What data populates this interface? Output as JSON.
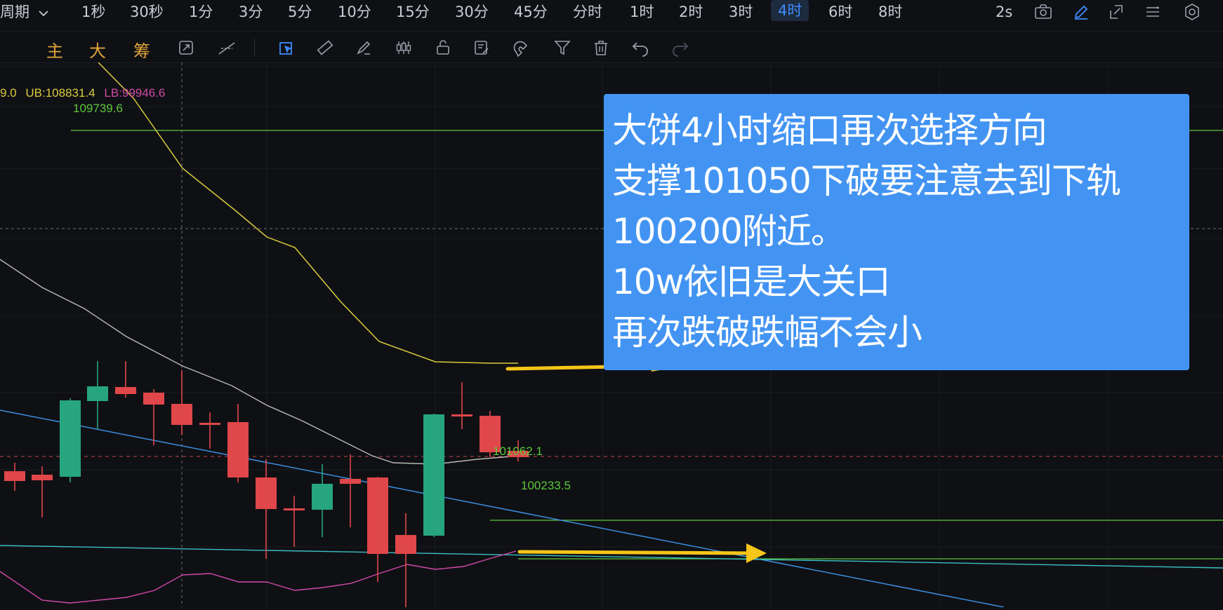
{
  "topbar": {
    "period_label": "周期",
    "timeframes": [
      "1秒",
      "30秒",
      "1分",
      "3分",
      "5分",
      "10分",
      "15分",
      "30分",
      "45分",
      "分时",
      "1时",
      "2时",
      "3时",
      "4时",
      "6时",
      "8时"
    ],
    "active_timeframe": "4时",
    "interval_value": "2s",
    "right_icons": [
      "camera-icon",
      "pencil-icon",
      "edit-frame-icon",
      "list-icon",
      "settings-icon"
    ]
  },
  "toolbar": {
    "indicators": [
      "主",
      "大",
      "筹"
    ],
    "tools": [
      "sync-icon",
      "crosshair-line-icon",
      "select-icon",
      "ruler-icon",
      "brush-icon",
      "candles-icon",
      "lock-icon",
      "notes-icon",
      "magnet-icon",
      "filter-icon",
      "trash-icon",
      "undo-icon",
      "redo-icon"
    ]
  },
  "indicator_legend": {
    "partial_value": "9.0",
    "ub": "UB:108831.4",
    "lb": "LB:99946.6"
  },
  "price_labels": {
    "upper": "109739.6",
    "support_1": "101062.1",
    "support_2": "100233.5"
  },
  "annotation": {
    "lines": [
      "大饼4小时缩口再次选择方向",
      "支撑101050下破要注意去到下轨",
      "100200附近。",
      "10w依旧是大关口",
      "再次跌破跌幅不会小"
    ]
  },
  "colors": {
    "bull": "#26a57f",
    "bear": "#e0474a",
    "ub_line": "#d9cc3c",
    "lb_line": "#d14aa8",
    "mid_line": "#b9b9b9",
    "trend_line": "#3a8ee0",
    "level_line": "#5cc63a",
    "arrow": "#f5c518",
    "annotation_bg": "#4394f2",
    "active_tab": "#3d8bfd"
  }
}
